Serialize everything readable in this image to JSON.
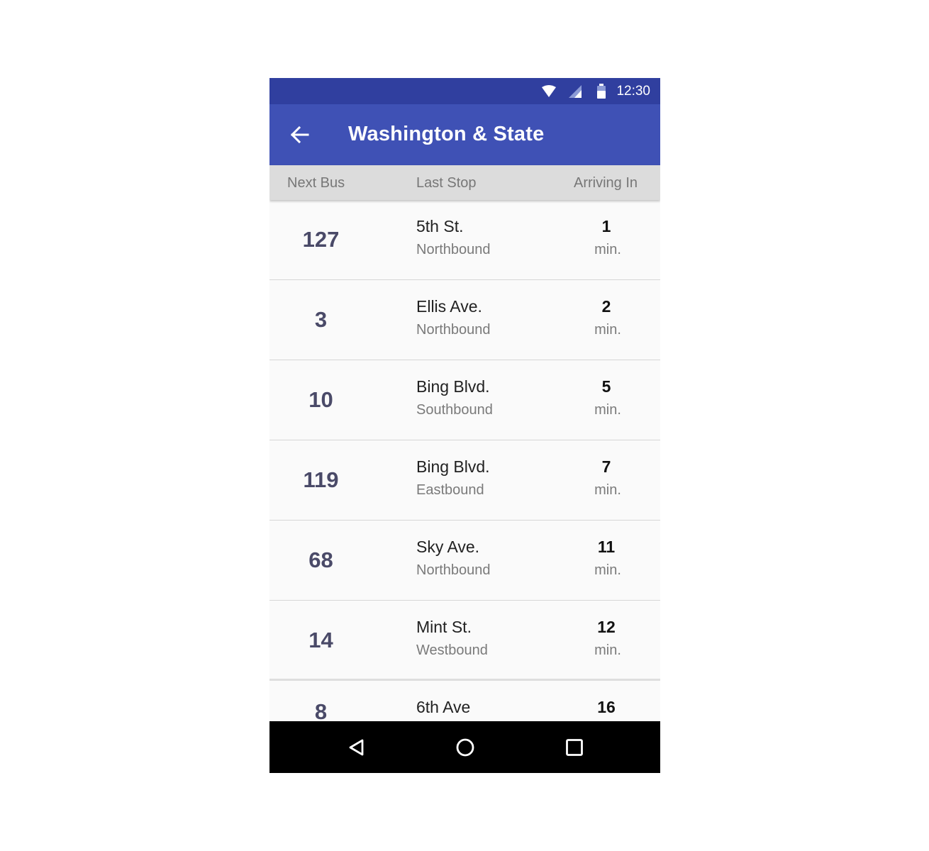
{
  "status_bar": {
    "time": "12:30",
    "icons": [
      "wifi-icon",
      "cellular-signal-icon",
      "battery-icon"
    ]
  },
  "app_bar": {
    "back_icon": "arrow-left-icon",
    "title": "Washington & State"
  },
  "columns": {
    "next_bus": "Next Bus",
    "last_stop": "Last Stop",
    "arriving_in": "Arriving In"
  },
  "arrivals": [
    {
      "bus": "127",
      "stop": "5th St.",
      "direction": "Northbound",
      "minutes": "1",
      "unit": "min."
    },
    {
      "bus": "3",
      "stop": "Ellis Ave.",
      "direction": "Northbound",
      "minutes": "2",
      "unit": "min."
    },
    {
      "bus": "10",
      "stop": "Bing Blvd.",
      "direction": "Southbound",
      "minutes": "5",
      "unit": "min."
    },
    {
      "bus": "119",
      "stop": "Bing Blvd.",
      "direction": "Eastbound",
      "minutes": "7",
      "unit": "min."
    },
    {
      "bus": "68",
      "stop": "Sky Ave.",
      "direction": "Northbound",
      "minutes": "11",
      "unit": "min."
    },
    {
      "bus": "14",
      "stop": "Mint St.",
      "direction": "Westbound",
      "minutes": "12",
      "unit": "min."
    },
    {
      "bus": "8",
      "stop": "6th Ave",
      "direction": "",
      "minutes": "16",
      "unit": ""
    }
  ],
  "nav_bar": {
    "icons": [
      "back-triangle-icon",
      "home-circle-icon",
      "recents-square-icon"
    ]
  },
  "colors": {
    "status_bar": "#303f9f",
    "app_bar": "#3f51b5",
    "header": "#dcdcdc",
    "bus_number": "#4a4a68"
  }
}
